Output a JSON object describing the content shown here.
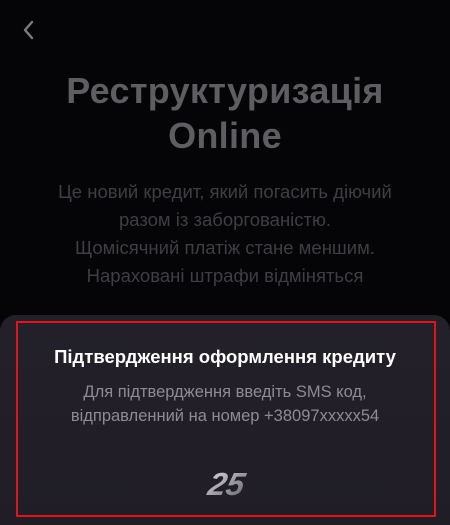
{
  "header": {
    "back_icon": "chevron-left-icon"
  },
  "main": {
    "title_line1": "Реструктуризація",
    "title_line2": "Online",
    "description_lines": [
      "Це новий кредит, який погасить діючий",
      "разом із заборгованістю.",
      "Щомісячний платіж стане меншим.",
      "Нараховані штрафи відміняться"
    ]
  },
  "sheet": {
    "title": "Підтвердження оформлення кредиту",
    "text_line1": "Для підтвердження введіть SMS код,",
    "text_line2": "відправленний на номер +38097xxxxx54",
    "timer_value": "25"
  },
  "colors": {
    "background": "#050406",
    "sheet": "#221f28",
    "highlight": "#e0141d"
  }
}
